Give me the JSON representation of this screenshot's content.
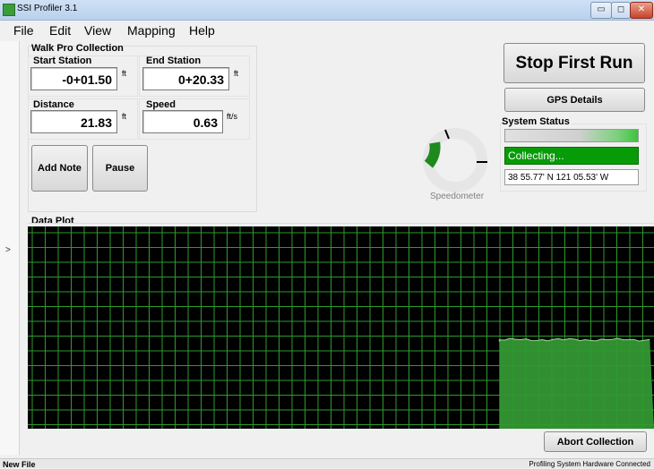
{
  "window": {
    "title": "SSI Profiler 3.1",
    "minimize_glyph": "▭",
    "maximize_glyph": "◻",
    "close_glyph": "✕"
  },
  "menu": {
    "items": [
      "File",
      "Edit",
      "View",
      "Mapping",
      "Help"
    ]
  },
  "side_toggle": ">",
  "walk_pro": {
    "title": "Walk Pro Collection",
    "start_station": {
      "label": "Start Station",
      "value": "-0+01.50",
      "unit": "ft"
    },
    "end_station": {
      "label": "End Station",
      "value": "0+20.33",
      "unit": "ft"
    },
    "distance": {
      "label": "Distance",
      "value": "21.83",
      "unit": "ft"
    },
    "speed": {
      "label": "Speed",
      "value": "0.63",
      "unit": "ft/s"
    },
    "add_note_label": "Add Note",
    "pause_label": "Pause"
  },
  "speedometer": {
    "label": "Speedometer",
    "level_fraction": 0.25
  },
  "right_panel": {
    "stop_run_label": "Stop First Run",
    "gps_details_label": "GPS Details",
    "system_status_title": "System Status",
    "status_text": "Collecting...",
    "coordinates": "38 55.77' N 121 05.53' W"
  },
  "data_plot": {
    "title": "Data Plot",
    "grid_color": "#2e9a2e",
    "fill_color": "#3aa83a",
    "data_start_fraction": 0.753,
    "data_level_fraction": 0.44
  },
  "abort_collection_label": "Abort Collection",
  "statusbar": {
    "file_status": "New File",
    "hardware_status": "Profiling System Hardware Connected"
  },
  "colors": {
    "accent_green": "#079b07",
    "titlebar": "#c3d8f1"
  }
}
